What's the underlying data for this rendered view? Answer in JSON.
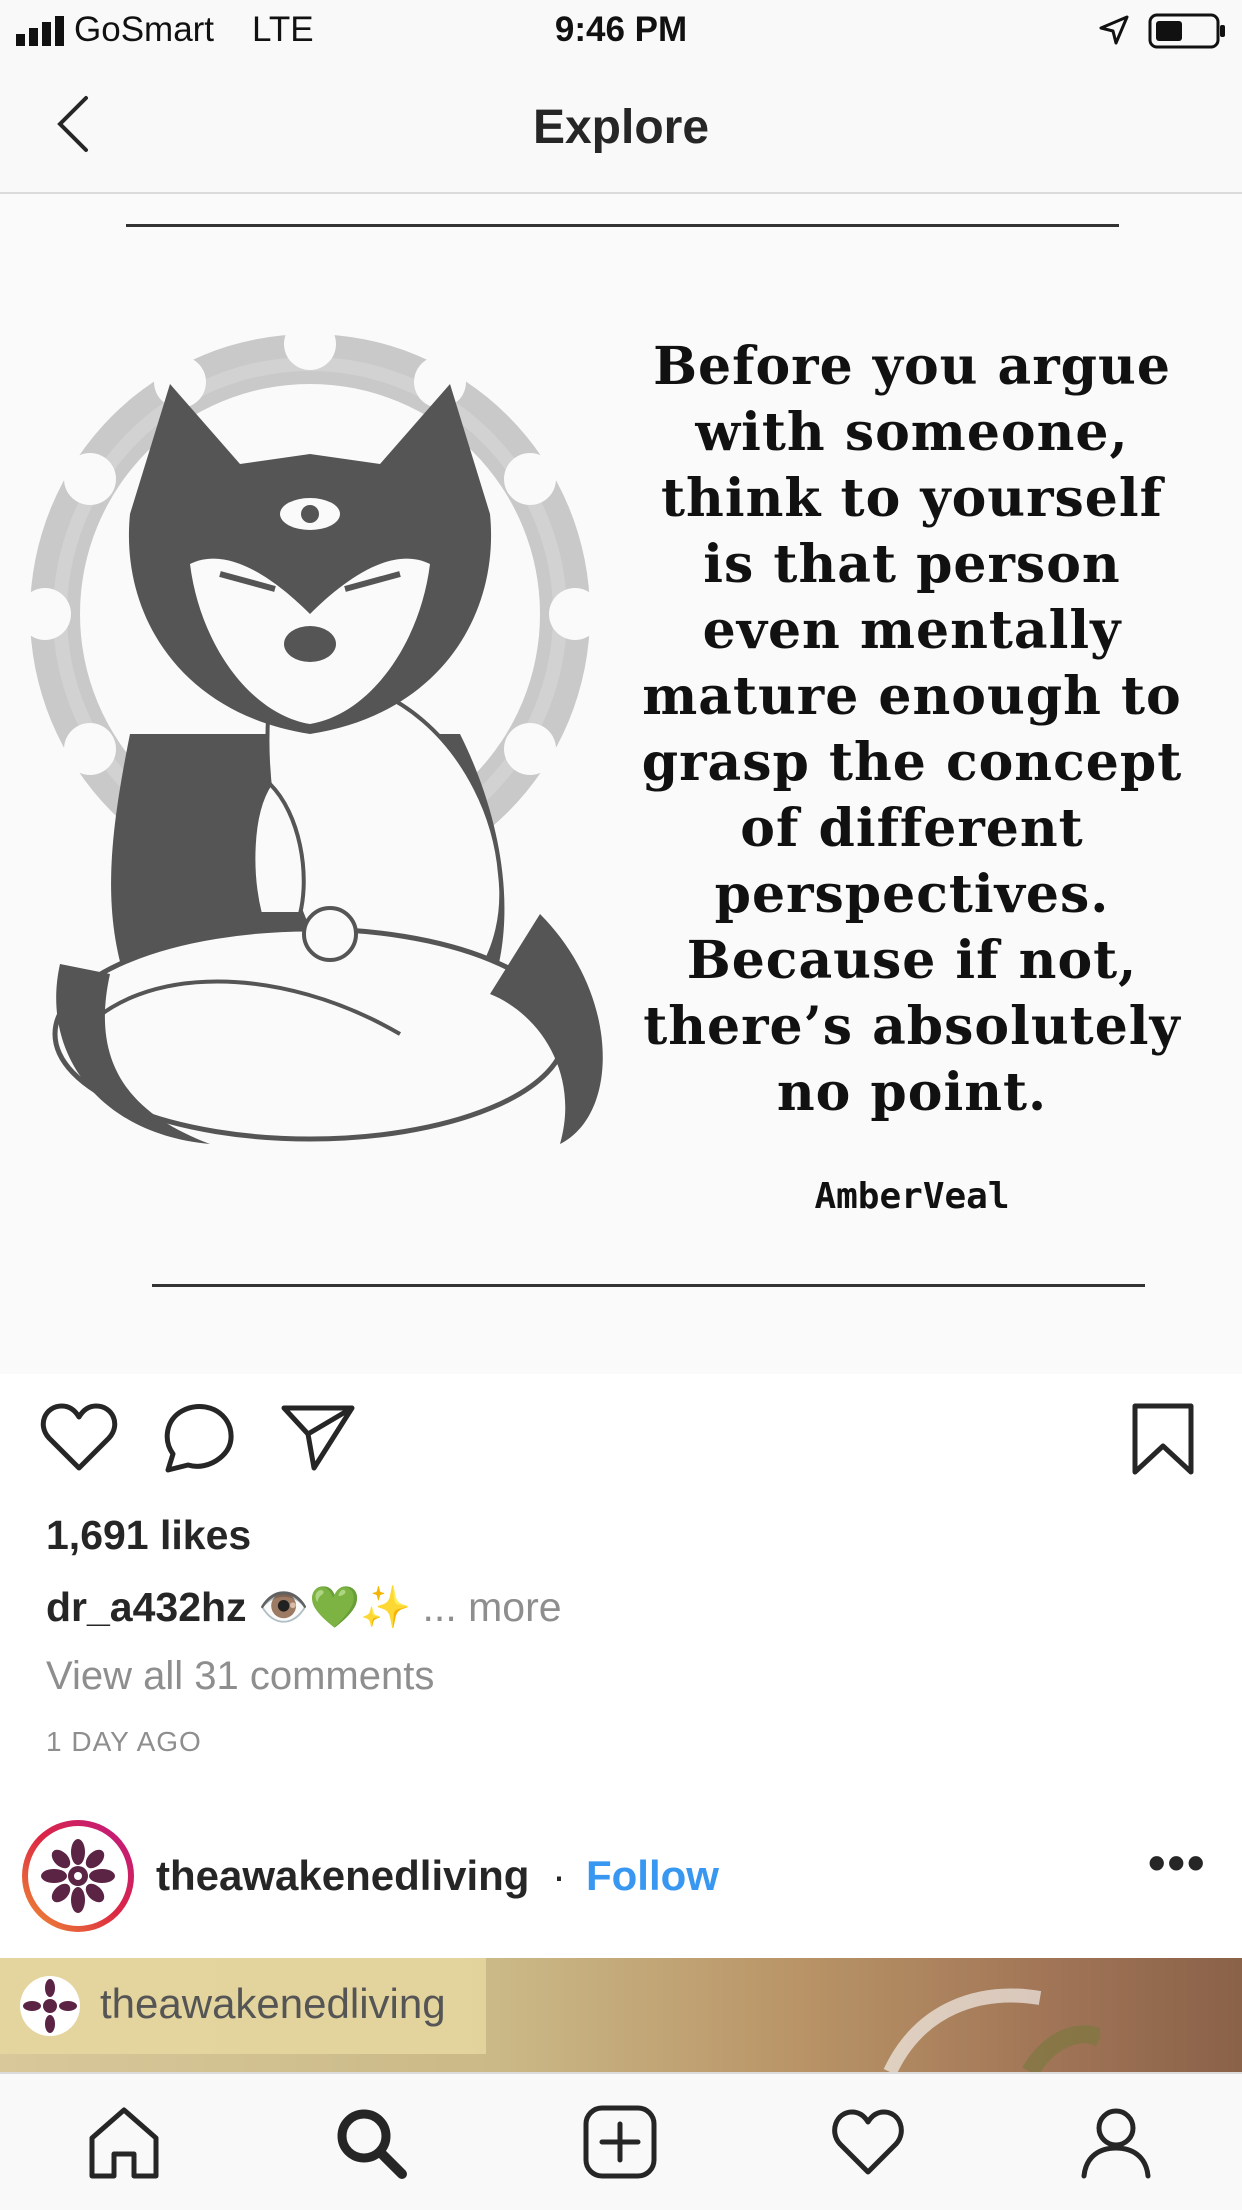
{
  "status_bar": {
    "carrier": "GoSmart",
    "network": "LTE",
    "time": "9:46 PM",
    "signal_icon": "signal-bars-icon",
    "location_icon": "location-arrow-icon",
    "battery_icon": "battery-icon",
    "battery_level_percent": 40
  },
  "nav": {
    "title": "Explore",
    "back_icon": "chevron-left-icon"
  },
  "post": {
    "quote_text": "Before you argue\nwith someone,\nthink to yourself\nis that person\neven mentally\nmature enough to\ngrasp the concept\nof different\nperspectives.\nBecause if not,\nthere’s absolutely\nno point.",
    "quote_author": "AmberVeal",
    "illustration": "meditating-wolf-illustration",
    "actions": {
      "like_icon": "heart-icon",
      "comment_icon": "comment-icon",
      "share_icon": "paper-plane-icon",
      "save_icon": "bookmark-icon"
    },
    "likes": "1,691 likes",
    "caption_user": "dr_a432hz",
    "caption_emoji": "👁️💚✨",
    "caption_ellipsis": "...",
    "caption_more": "more",
    "view_comments": "View all 31 comments",
    "timestamp": "1 DAY AGO"
  },
  "next_post": {
    "username": "theawakenedliving",
    "separator": "·",
    "follow_label": "Follow",
    "more_icon": "more-horizontal-icon",
    "more_label": "•••",
    "image_tag_username": "theawakenedliving"
  },
  "tab_bar": {
    "items": [
      "home-icon",
      "search-icon",
      "add-post-icon",
      "activity-heart-icon",
      "profile-icon"
    ],
    "active": "search-icon"
  },
  "colors": {
    "link_blue": "#3897f0",
    "secondary_gray": "#8e8e8e",
    "avatar_ring": "#bc1888",
    "avatar_mandala": "#5b2344"
  }
}
